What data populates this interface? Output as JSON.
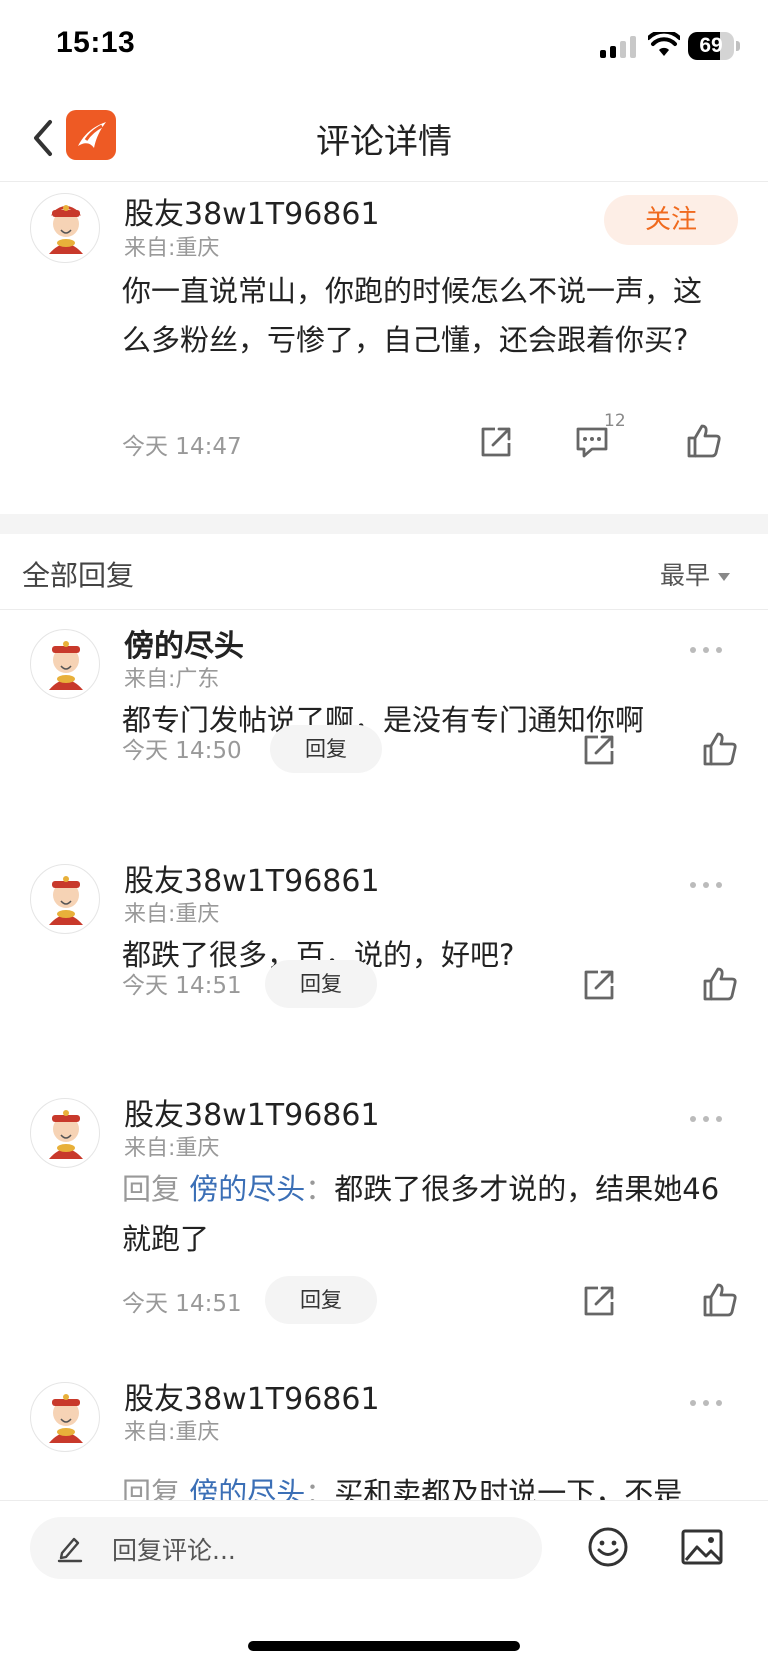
{
  "status_bar": {
    "time": "15:13",
    "battery": "69",
    "battery_level": 0.69
  },
  "nav": {
    "title": "评论详情"
  },
  "main_comment": {
    "username": "股友38w1T96861",
    "location": "来自:重庆",
    "follow_label": "关注",
    "text": "你一直说常山，你跑的时候怎么不说一声，这么多粉丝，亏惨了，自己懂，还会跟着你买?",
    "time": "今天 14:47",
    "reply_count": "12"
  },
  "replies_header": {
    "title": "全部回复",
    "sort_label": "最早"
  },
  "replies": [
    {
      "username": "傍的尽头",
      "location": "来自:广东",
      "text": "都专门发帖说了啊，是没有专门通知你啊",
      "time": "今天 14:50",
      "reply_label": "回复"
    },
    {
      "username": "股友38w1T96861",
      "location": "来自:重庆",
      "text": "都跌了很多，百，说的，好吧?",
      "time": "今天 14:51",
      "reply_label": "回复"
    },
    {
      "username": "股友38w1T96861",
      "location": "来自:重庆",
      "prefix": "回复",
      "mention": "傍的尽头",
      "separator": "：",
      "text": "都跌了很多才说的，结果她46就跑了",
      "time": "今天 14:51",
      "reply_label": "回复"
    },
    {
      "username": "股友38w1T96861",
      "location": "来自:重庆",
      "prefix": "回复",
      "mention": "傍的尽头",
      "separator": "：",
      "text": "买和卖都及时说一下，不是"
    }
  ],
  "bottom_bar": {
    "input_placeholder": "回复评论..."
  },
  "colors": {
    "accent": "#f06a1e",
    "follow_bg": "#fdeee6",
    "mention": "#3b6fb6",
    "app_logo": "#ee5a24"
  },
  "icons": [
    "back-arrow-icon",
    "app-logo-icon",
    "share-icon",
    "comment-icon",
    "like-icon",
    "more-dots-icon",
    "pencil-icon",
    "emoji-icon",
    "image-icon",
    "signal-icon",
    "wifi-icon",
    "battery-icon"
  ]
}
